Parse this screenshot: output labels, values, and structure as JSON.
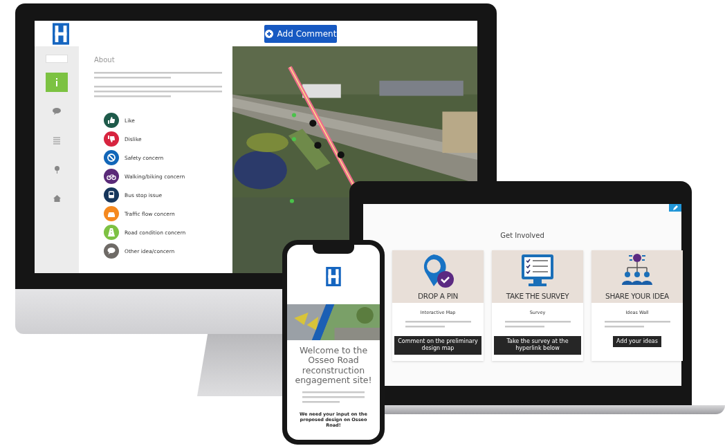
{
  "monitor": {
    "header": {
      "button": "Add Comment"
    },
    "sidebar": [
      {
        "kind": "back",
        "selected": false
      },
      {
        "kind": "info",
        "selected": true
      },
      {
        "kind": "comment",
        "selected": false
      },
      {
        "kind": "list",
        "selected": false
      },
      {
        "kind": "pin",
        "selected": false
      },
      {
        "kind": "home",
        "selected": false
      }
    ],
    "panel": {
      "title": "About",
      "legend": [
        {
          "label": "Like",
          "kind": "like",
          "color": "#1e5a4a"
        },
        {
          "label": "Dislike",
          "kind": "dislike",
          "color": "#d7243f"
        },
        {
          "label": "Safety concern",
          "kind": "safety",
          "color": "#1166b8"
        },
        {
          "label": "Walking/biking concern",
          "kind": "bike",
          "color": "#5a2a78"
        },
        {
          "label": "Bus stop issue",
          "kind": "bus",
          "color": "#16365c"
        },
        {
          "label": "Traffic flow concern",
          "kind": "car",
          "color": "#f5891f"
        },
        {
          "label": "Road condition concern",
          "kind": "road",
          "color": "#7dc142"
        },
        {
          "label": "Other idea/concern",
          "kind": "chat",
          "color": "#6e6a66"
        }
      ]
    }
  },
  "laptop": {
    "title": "Get Involved",
    "cards": [
      {
        "kind": "pin",
        "banner": "DROP A PIN",
        "heading": "Interactive Map",
        "button": "Comment on the preliminary design map"
      },
      {
        "kind": "survey",
        "banner": "TAKE THE SURVEY",
        "heading": "Survey",
        "button": "Take the survey at the hyperlink below"
      },
      {
        "kind": "idea",
        "banner": "SHARE YOUR IDEA",
        "heading": "Ideas Wall",
        "button": "Add your ideas"
      }
    ]
  },
  "phone": {
    "welcome": "Welcome to the Osseo Road reconstruction engagement site!",
    "prompt": "We need your input on the proposed design on Osseo Road!"
  }
}
